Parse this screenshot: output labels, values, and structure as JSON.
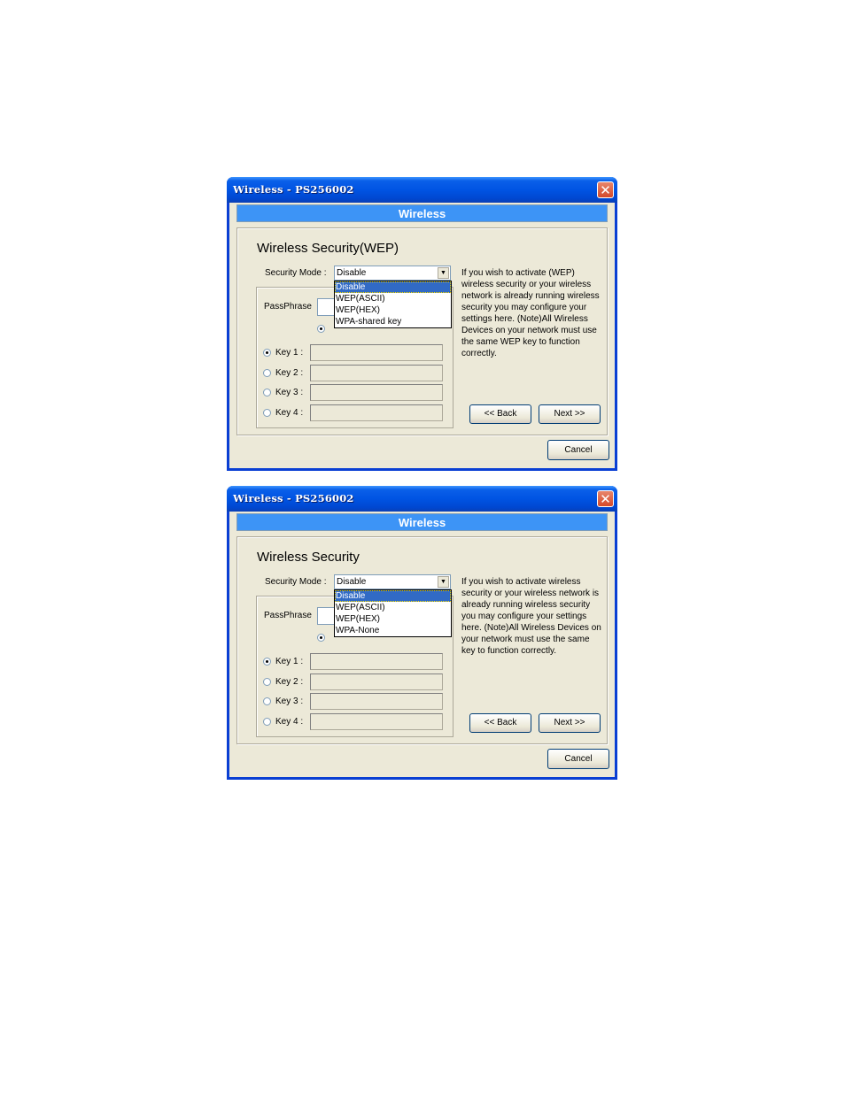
{
  "dialogs": [
    {
      "window_title": "Wireless - PS256002",
      "banner": "Wireless",
      "heading": "Wireless Security(WEP)",
      "security_mode_label": "Security Mode :",
      "security_mode_value": "Disable",
      "dropdown_options": [
        "Disable",
        "WEP(ASCII)",
        "WEP(HEX)",
        "WPA-shared key"
      ],
      "selected_option": "Disable",
      "passphrase_label": "PassPhrase",
      "keys": [
        {
          "label": "Key 1 :",
          "selected": true,
          "value": ""
        },
        {
          "label": "Key 2 :",
          "selected": false,
          "value": ""
        },
        {
          "label": "Key 3 :",
          "selected": false,
          "value": ""
        },
        {
          "label": "Key 4 :",
          "selected": false,
          "value": ""
        }
      ],
      "help_text": "If you wish to activate (WEP) wireless security or your wireless network is already running wireless security you may configure your settings here. (Note)All Wireless Devices on your network must use the same WEP key to function correctly.",
      "back_label": "<< Back",
      "next_label": "Next >>",
      "cancel_label": "Cancel",
      "close_glyph": "✕"
    },
    {
      "window_title": "Wireless - PS256002",
      "banner": "Wireless",
      "heading": "Wireless Security",
      "security_mode_label": "Security Mode :",
      "security_mode_value": "Disable",
      "dropdown_options": [
        "Disable",
        "WEP(ASCII)",
        "WEP(HEX)",
        "WPA-None"
      ],
      "selected_option": "Disable",
      "passphrase_label": "PassPhrase",
      "keys": [
        {
          "label": "Key 1 :",
          "selected": true,
          "value": ""
        },
        {
          "label": "Key 2 :",
          "selected": false,
          "value": ""
        },
        {
          "label": "Key 3 :",
          "selected": false,
          "value": ""
        },
        {
          "label": "Key 4 :",
          "selected": false,
          "value": ""
        }
      ],
      "help_text": "If you wish to activate wireless security or your wireless network is already running wireless security you may configure your settings here. (Note)All Wireless Devices on your network must use the same key to function correctly.",
      "back_label": "<< Back",
      "next_label": "Next >>",
      "cancel_label": "Cancel",
      "close_glyph": "✕"
    }
  ],
  "colors": {
    "titlebar": "#0054e3",
    "banner": "#3d94f6",
    "dialog_bg": "#ece9d8",
    "selection": "#316ac5",
    "close_button": "#d4492a"
  }
}
